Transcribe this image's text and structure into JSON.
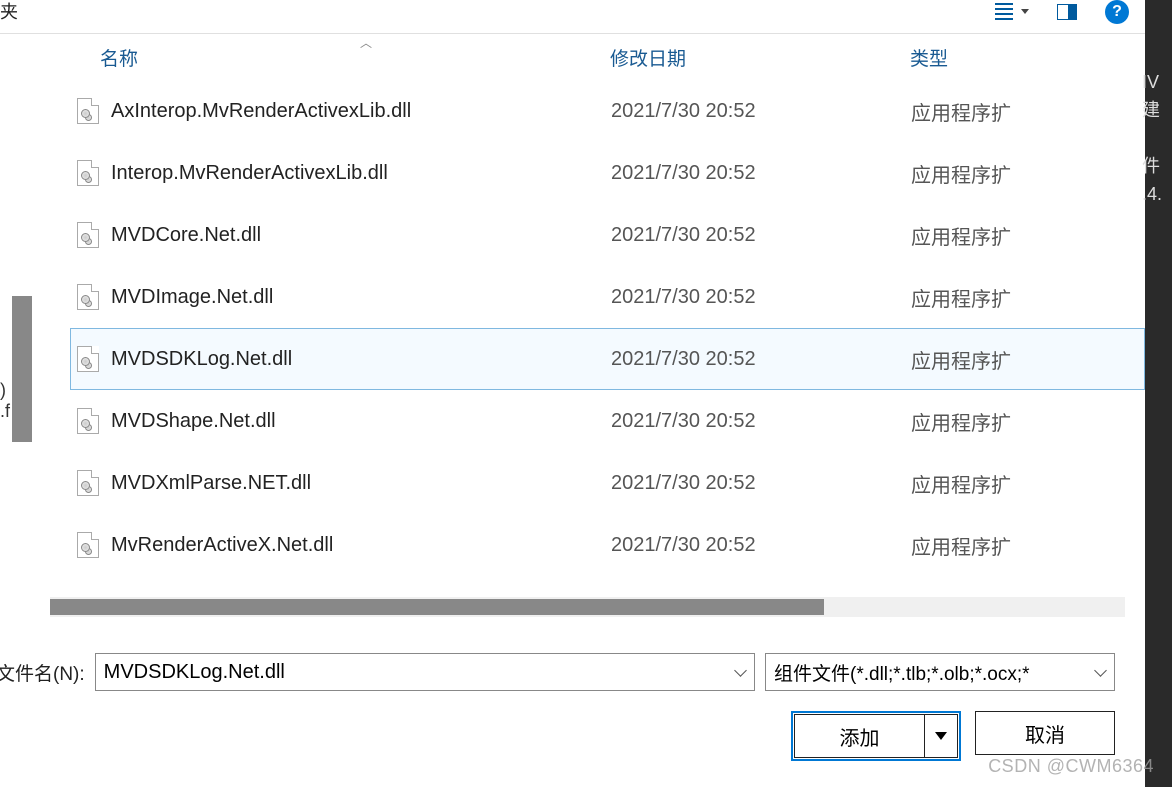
{
  "toolbar": {
    "left_fragment": "夹"
  },
  "columns": {
    "name": "名称",
    "date": "修改日期",
    "type": "类型"
  },
  "files": [
    {
      "name": "AxInterop.MvRenderActivexLib.dll",
      "date": "2021/7/30 20:52",
      "type": "应用程序扩",
      "selected": false
    },
    {
      "name": "Interop.MvRenderActivexLib.dll",
      "date": "2021/7/30 20:52",
      "type": "应用程序扩",
      "selected": false
    },
    {
      "name": "MVDCore.Net.dll",
      "date": "2021/7/30 20:52",
      "type": "应用程序扩",
      "selected": false
    },
    {
      "name": "MVDImage.Net.dll",
      "date": "2021/7/30 20:52",
      "type": "应用程序扩",
      "selected": false
    },
    {
      "name": "MVDSDKLog.Net.dll",
      "date": "2021/7/30 20:52",
      "type": "应用程序扩",
      "selected": true
    },
    {
      "name": "MVDShape.Net.dll",
      "date": "2021/7/30 20:52",
      "type": "应用程序扩",
      "selected": false
    },
    {
      "name": "MVDXmlParse.NET.dll",
      "date": "2021/7/30 20:52",
      "type": "应用程序扩",
      "selected": false
    },
    {
      "name": "MvRenderActiveX.Net.dll",
      "date": "2021/7/30 20:52",
      "type": "应用程序扩",
      "selected": false
    }
  ],
  "footer": {
    "filename_label": "文件名(N):",
    "filename_value": "MVDSDKLog.Net.dll",
    "filter_value": "组件文件(*.dll;*.tlb;*.olb;*.ocx;*",
    "add_label": "添加",
    "cancel_label": "取消"
  },
  "watermark": "CSDN @CWM6364",
  "bg_fragments": {
    "right": "IV\n建\n\n件\n.4.",
    "left": ")\n\n\n\n.f"
  }
}
